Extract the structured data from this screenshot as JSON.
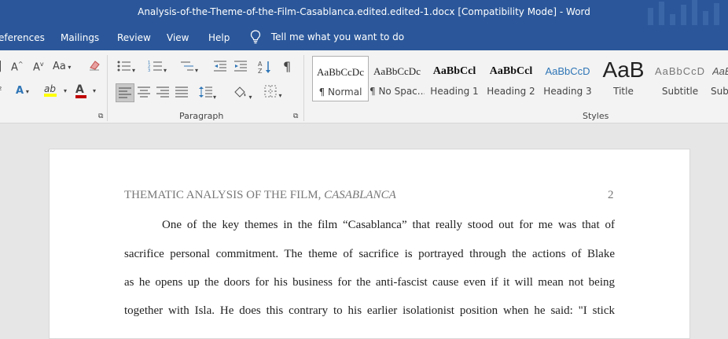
{
  "window": {
    "title": "Analysis-of-the-Theme-of-the-Film-Casablanca.edited.edited-1.docx [Compatibility Mode]  -  Word"
  },
  "menu": {
    "tabs": [
      "eferences",
      "Mailings",
      "Review",
      "View",
      "Help"
    ],
    "tell_me": "Tell me what you want to do"
  },
  "ribbon": {
    "paragraph_label": "Paragraph",
    "styles_label": "Styles",
    "styles": [
      {
        "sample": "AaBbCcDc",
        "name": "¶ Normal"
      },
      {
        "sample": "AaBbCcDc",
        "name": "¶ No Spac..."
      },
      {
        "sample": "AaBbCcl",
        "name": "Heading 1"
      },
      {
        "sample": "AaBbCcl",
        "name": "Heading 2"
      },
      {
        "sample": "AaBbCcD",
        "name": "Heading 3"
      },
      {
        "sample": "AaB",
        "name": "Title"
      },
      {
        "sample": "AaBbCcD",
        "name": "Subtitle"
      },
      {
        "sample": "AaB",
        "name": "Sub"
      }
    ],
    "colors": {
      "highlight": "#ffff00",
      "font_color": "#c00000"
    }
  },
  "document": {
    "header_main": "THEMATIC ANALYSIS OF THE FILM, ",
    "header_italic": "CASABLANCA",
    "page_number": "2",
    "lines": [
      "One of the key themes in the film “Casablanca” that really stood out for me was that of",
      "sacrifice personal commitment. The theme of sacrifice is portrayed through the actions of Blake",
      "as he opens up the doors for his business for the anti-fascist cause even if it will mean not being",
      "together with Isla. He does this contrary to his earlier isolationist position when he said: \"I stick"
    ]
  },
  "theme": {
    "brand_blue": "#2b579a"
  }
}
